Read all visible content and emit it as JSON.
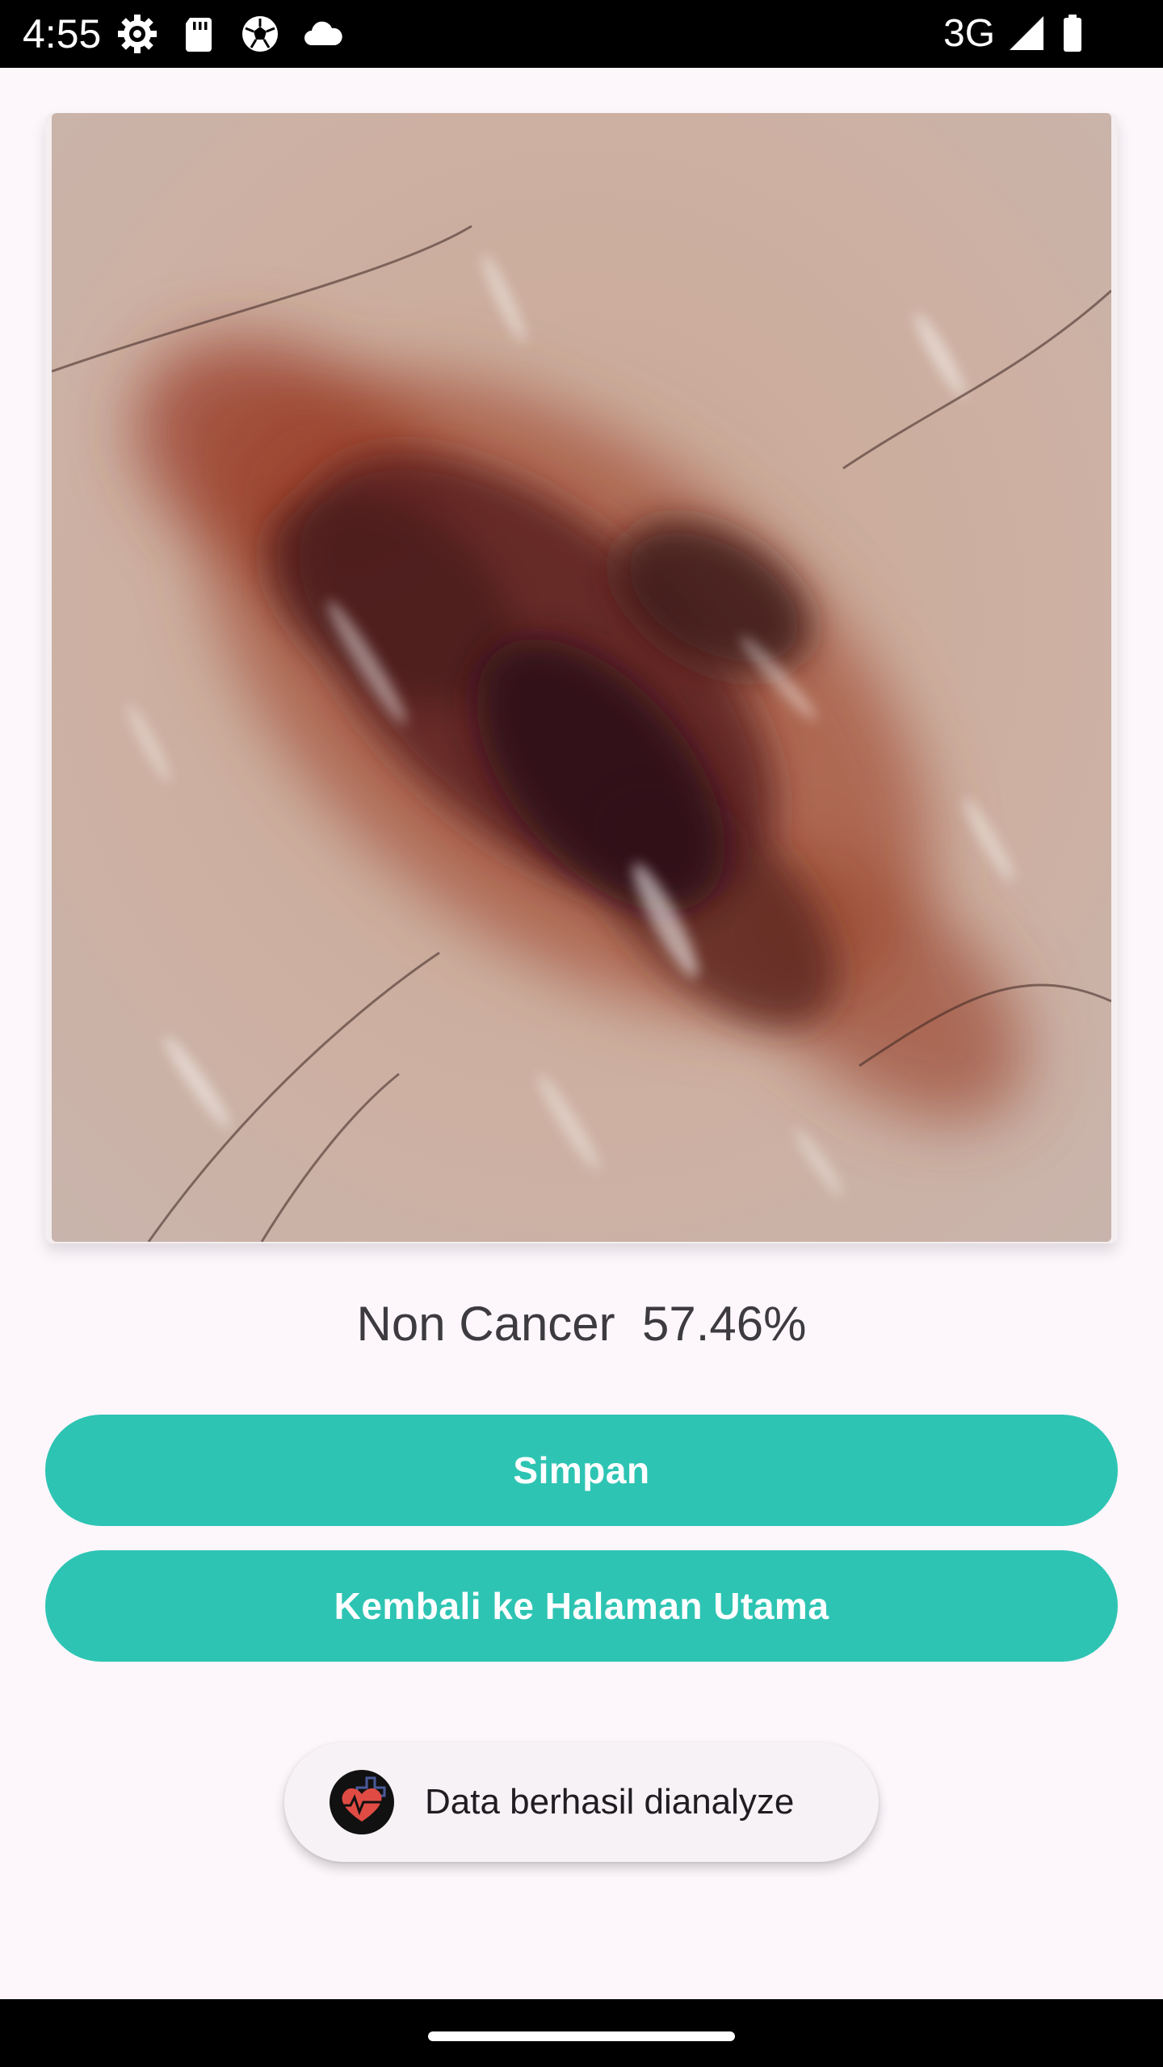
{
  "status_bar": {
    "time": "4:55",
    "network": "3G",
    "icons": [
      "settings-gear-icon",
      "sd-card-icon",
      "soccer-ball-icon",
      "cloud-icon",
      "signal-icon",
      "battery-icon"
    ]
  },
  "analysis": {
    "image_subject": "skin-lesion-photo",
    "result_label": "Non Cancer",
    "result_confidence": "57.46%"
  },
  "buttons": {
    "save_label": "Simpan",
    "home_label": "Kembali ke Halaman Utama"
  },
  "toast": {
    "icon": "heart-pulse-logo-icon",
    "message": "Data berhasil dianalyze"
  },
  "colors": {
    "accent": "#2ec4b3",
    "background": "#fdf7fc",
    "toast_background": "#f7f2f5",
    "text_primary": "#3d3b40"
  }
}
